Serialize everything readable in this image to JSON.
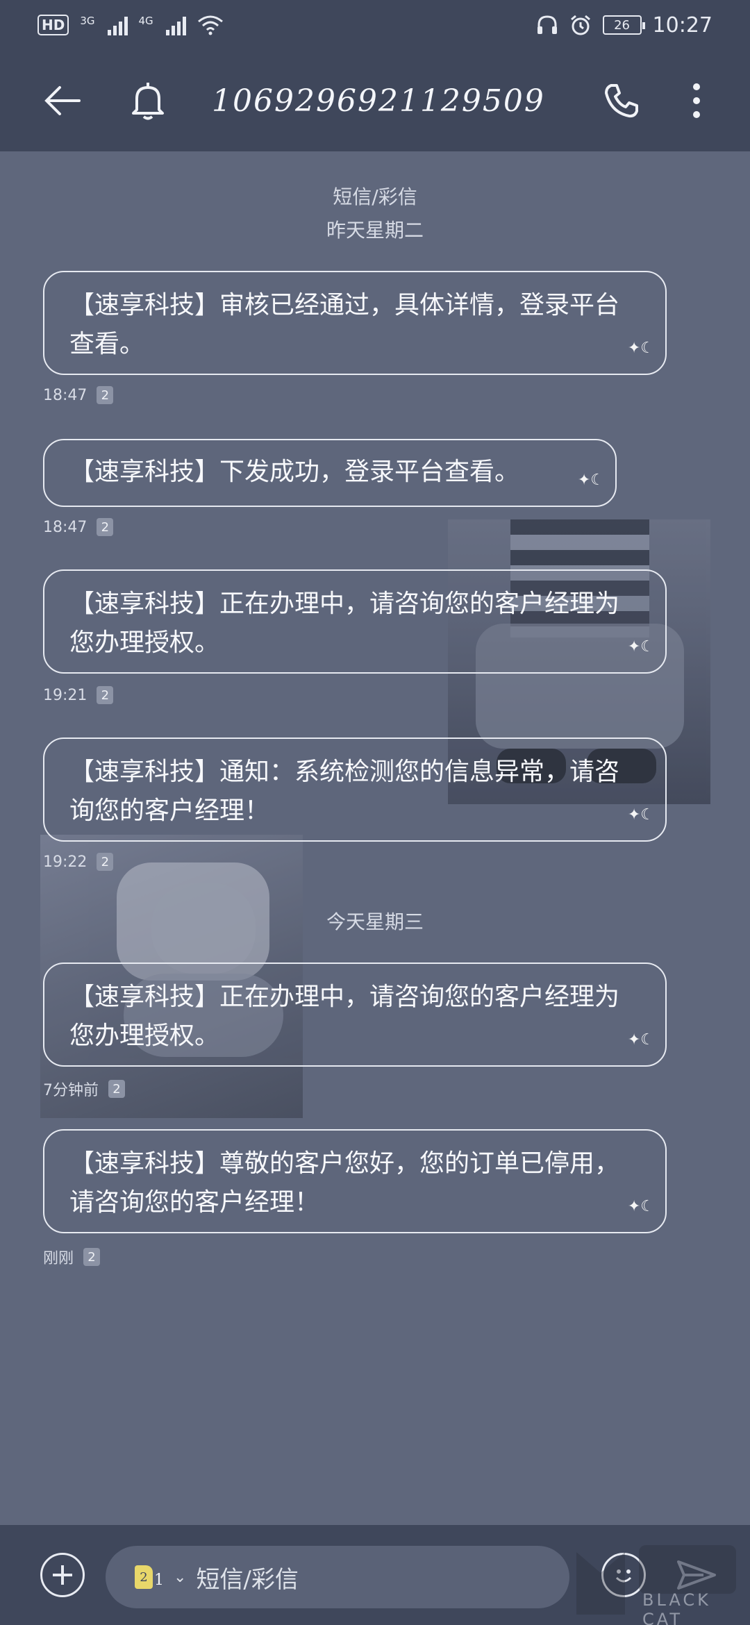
{
  "status_bar": {
    "hd_label": "HD",
    "sim1_label": "3G",
    "sim2_label": "4G",
    "battery": "26",
    "time": "10:27"
  },
  "header": {
    "title": "1069296921129509"
  },
  "thread": {
    "type_label": "短信/彩信",
    "day1_label": "昨天星期二",
    "day2_label": "今天星期三"
  },
  "messages": [
    {
      "text": "【速享科技】审核已经通过，具体详情，登录平台查看。",
      "time": "18:47",
      "sim": "2"
    },
    {
      "text": "【速享科技】下发成功，登录平台查看。",
      "time": "18:47",
      "sim": "2"
    },
    {
      "text": "【速享科技】正在办理中，请咨询您的客户经理为您办理授权。",
      "time": "19:21",
      "sim": "2"
    },
    {
      "text": "【速享科技】通知：系统检测您的信息异常，请咨询您的客户经理！",
      "time": "19:22",
      "sim": "2"
    },
    {
      "text": "【速享科技】正在办理中，请咨询您的客户经理为您办理授权。",
      "time": "7分钟前",
      "sim": "2"
    },
    {
      "text": "【速享科技】尊敬的客户您好，您的订单已停用，请咨询您的客户经理！",
      "time": "刚刚",
      "sim": "2"
    }
  ],
  "composer": {
    "placeholder": "短信/彩信",
    "sim_number": "1",
    "sim_card_label": "2"
  },
  "watermark": {
    "text": "BLACK CAT"
  }
}
